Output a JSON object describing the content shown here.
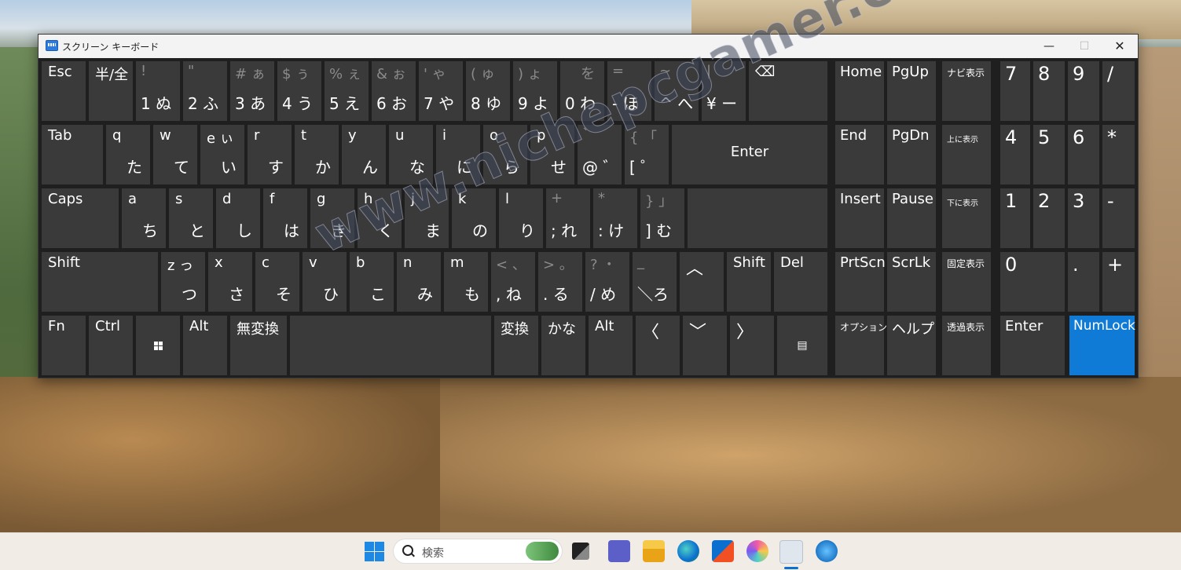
{
  "window": {
    "title": "スクリーン キーボード",
    "min": "—",
    "max": "☐",
    "close": "✕"
  },
  "keys": {
    "esc": "Esc",
    "hankaku": "半/全",
    "n1": [
      "!",
      "1 ぬ"
    ],
    "n2": [
      "\"",
      "2 ふ"
    ],
    "n3": [
      "# ぁ",
      "3 あ"
    ],
    "n4": [
      "$ ぅ",
      "4 う"
    ],
    "n5": [
      "% ぇ",
      "5 え"
    ],
    "n6": [
      "& ぉ",
      "6 お"
    ],
    "n7": [
      "' ゃ",
      "7 や"
    ],
    "n8": [
      "( ゅ",
      "8 ゆ"
    ],
    "n9": [
      ") ょ",
      "9 よ"
    ],
    "n0": [
      "を",
      "0 わ"
    ],
    "minus": [
      "=",
      "- ほ"
    ],
    "caret": [
      "~",
      "^ へ"
    ],
    "yen": [
      "|",
      "¥ ー"
    ],
    "bksp": "⌫",
    "tab": "Tab",
    "q": [
      "q",
      "た"
    ],
    "w": [
      "w",
      "て"
    ],
    "e": [
      "e ぃ",
      "い"
    ],
    "r": [
      "r",
      "す"
    ],
    "t": [
      "t",
      "か"
    ],
    "y": [
      "y",
      "ん"
    ],
    "u": [
      "u",
      "な"
    ],
    "i": [
      "i",
      "に"
    ],
    "o": [
      "o",
      "ら"
    ],
    "p": [
      "p",
      "せ"
    ],
    "at": [
      "`",
      "@ ゛"
    ],
    "bracket": [
      "{ 「",
      "[ ゜"
    ],
    "enter": "Enter",
    "caps": "Caps",
    "a": [
      "a",
      "ち"
    ],
    "s": [
      "s",
      "と"
    ],
    "d": [
      "d",
      "し"
    ],
    "f": [
      "f",
      "は"
    ],
    "g": [
      "g",
      "き"
    ],
    "h": [
      "h",
      "く"
    ],
    "j": [
      "j",
      "ま"
    ],
    "k": [
      "k",
      "の"
    ],
    "l": [
      "l",
      "り"
    ],
    "semi": [
      "+",
      "; れ"
    ],
    "colon": [
      "*",
      ": け"
    ],
    "rbracket": [
      "} 」",
      "] む"
    ],
    "shift": "Shift",
    "z": [
      "z っ",
      "つ"
    ],
    "x": [
      "x",
      "さ"
    ],
    "c": [
      "c",
      "そ"
    ],
    "v": [
      "v",
      "ひ"
    ],
    "b": [
      "b",
      "こ"
    ],
    "n": [
      "n",
      "み"
    ],
    "m": [
      "m",
      "も"
    ],
    "comma": [
      "< 、",
      ", ね"
    ],
    "period": [
      "> 。",
      ". る"
    ],
    "slash": [
      "? ・",
      "/ め"
    ],
    "backslash": [
      "_",
      "＼ろ"
    ],
    "up": "︿",
    "rshift": "Shift",
    "del": "Del",
    "fn": "Fn",
    "ctrl": "Ctrl",
    "alt": "Alt",
    "muhenkan": "無変換",
    "henkan": "変換",
    "kana": "かな",
    "ralt": "Alt",
    "left": "〈",
    "down": "﹀",
    "right": "〉",
    "menu": "▤",
    "home": "Home",
    "pgup": "PgUp",
    "navi": "ナビ表示",
    "end": "End",
    "pgdn": "PgDn",
    "upshow": "上に表示",
    "insert": "Insert",
    "pause": "Pause",
    "downshow": "下に表示",
    "prtscn": "PrtScn",
    "scrlk": "ScrLk",
    "fixshow": "固定表示",
    "option": "オプション",
    "help": "ヘルプ",
    "transparent": "透過表示",
    "p7": "7",
    "p8": "8",
    "p9": "9",
    "pslash": "/",
    "p4": "4",
    "p5": "5",
    "p6": "6",
    "pstar": "*",
    "p1": "1",
    "p2": "2",
    "p3": "3",
    "pminus": "-",
    "p0": "0",
    "pdot": ".",
    "pplus": "+",
    "penter": "Enter",
    "numlock": "NumLock"
  },
  "watermark": "www.nichepcgamer.com",
  "taskbar": {
    "search_placeholder": "検索"
  },
  "colors": {
    "key_bg": "#3a3a3a",
    "window_bg": "#1f1f1f",
    "numlock_active": "#0f7bd6"
  }
}
